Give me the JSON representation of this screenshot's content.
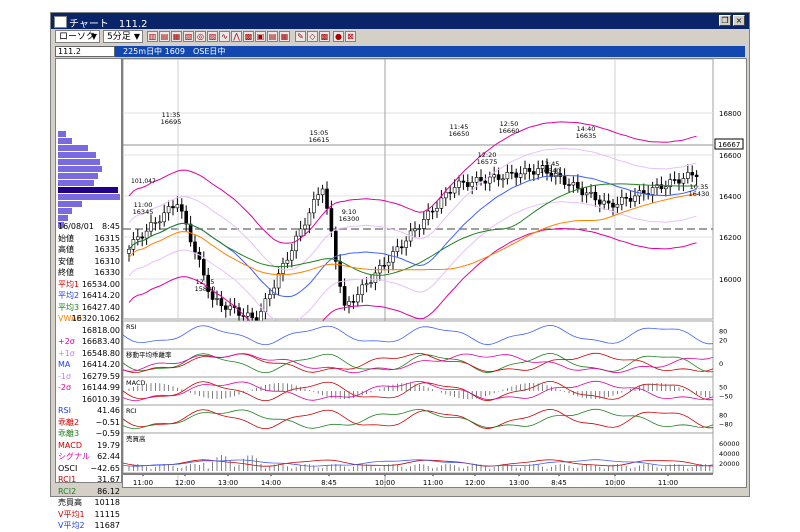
{
  "window": {
    "title": "チャート　111.2",
    "close": "×",
    "restore": "❐"
  },
  "toolbar": {
    "symbol_dd": "ローソク",
    "interval_dd": "5分足",
    "arrow": "▼"
  },
  "symbolbar": {
    "code": "111.2",
    "session_label": "225m日中 1609",
    "exchange_label": "OSE日中"
  },
  "colors": {
    "title_bg": "#0a246a",
    "symbar_bg": "#1248b0",
    "ma1": "#e000a0",
    "ma2": "#4060ff",
    "ma3": "#208020",
    "vwap": "#ff8000",
    "profile": "#7a6ae0"
  },
  "info": {
    "date": "16/08/01",
    "time": "8:45",
    "rows": [
      {
        "k": "始値",
        "v": "16315",
        "c": "#000"
      },
      {
        "k": "高値",
        "v": "16335",
        "c": "#000"
      },
      {
        "k": "安値",
        "v": "16310",
        "c": "#000"
      },
      {
        "k": "終値",
        "v": "16330",
        "c": "#000"
      },
      {
        "k": "平均1",
        "v": "16534.00",
        "c": "#d00000"
      },
      {
        "k": "平均2",
        "v": "16414.20",
        "c": "#2040ff"
      },
      {
        "k": "平均3",
        "v": "16427.40",
        "c": "#208020"
      },
      {
        "k": "VWAP",
        "v": "16320.1062",
        "c": "#ff8000"
      },
      {
        "k": "",
        "v": "16818.00",
        "c": "#000"
      },
      {
        "k": "+2σ",
        "v": "16683.40",
        "c": "#e000a0"
      },
      {
        "k": "+1σ",
        "v": "16548.80",
        "c": "#c080ff"
      },
      {
        "k": "MA",
        "v": "16414.20",
        "c": "#2040ff"
      },
      {
        "k": "-1σ",
        "v": "16279.59",
        "c": "#c080ff"
      },
      {
        "k": "-2σ",
        "v": "16144.99",
        "c": "#e000a0"
      },
      {
        "k": "",
        "v": "16010.39",
        "c": "#000"
      },
      {
        "k": "RSI",
        "v": "41.46",
        "c": "#2040ff"
      },
      {
        "k": "乖離2",
        "v": "−0.51",
        "c": "#d00000"
      },
      {
        "k": "乖離3",
        "v": "−0.59",
        "c": "#208020"
      },
      {
        "k": "MACD",
        "v": "19.79",
        "c": "#d00000"
      },
      {
        "k": "シグナル",
        "v": "62.44",
        "c": "#e000a0"
      },
      {
        "k": "OSCI",
        "v": "−42.65",
        "c": "#000"
      },
      {
        "k": "RCI1",
        "v": "31.67",
        "c": "#d00000"
      },
      {
        "k": "RCI2",
        "v": "86.12",
        "c": "#208020"
      },
      {
        "k": "売買高",
        "v": "10118",
        "c": "#000"
      },
      {
        "k": "V平均1",
        "v": "11115",
        "c": "#d00000"
      },
      {
        "k": "V平均2",
        "v": "11687",
        "c": "#2040ff"
      }
    ]
  },
  "price_axis": {
    "ticks": [
      "16800",
      "16600",
      "16400",
      "16200",
      "16000"
    ],
    "current": "16667"
  },
  "annotations": [
    {
      "time": "11:35",
      "price": "16695"
    },
    {
      "time": "11:00",
      "price": "16345"
    },
    {
      "time": "12:15",
      "price": "15880"
    },
    {
      "time": "15:05",
      "price": "16615"
    },
    {
      "time": "9:10",
      "price": "16300"
    },
    {
      "time": "11:45",
      "price": "16650"
    },
    {
      "time": "12:50",
      "price": "16660"
    },
    {
      "time": "12:20",
      "price": "16575"
    },
    {
      "time": "13:45",
      "price": "16540"
    },
    {
      "time": "14:40",
      "price": "16635"
    },
    {
      "time": "10:35",
      "price": "16430"
    }
  ],
  "panels": [
    {
      "name": "RSI",
      "ticks": [
        "80",
        "20"
      ]
    },
    {
      "name": "移動平均乖離率",
      "ticks": [
        "0"
      ]
    },
    {
      "name": "MACD",
      "ticks": [
        "50",
        "−50"
      ]
    },
    {
      "name": "RCI",
      "ticks": [
        "80",
        "−80"
      ]
    },
    {
      "name": "売買高",
      "ticks": [
        "60000",
        "40000",
        "20000"
      ]
    }
  ],
  "time_axis": [
    "11:00",
    "12:00",
    "13:00",
    "14:00",
    "8:45",
    "10:00",
    "11:00",
    "12:00",
    "13:00",
    "8:45",
    "10:00",
    "11:00"
  ],
  "small_label": "101,047"
}
